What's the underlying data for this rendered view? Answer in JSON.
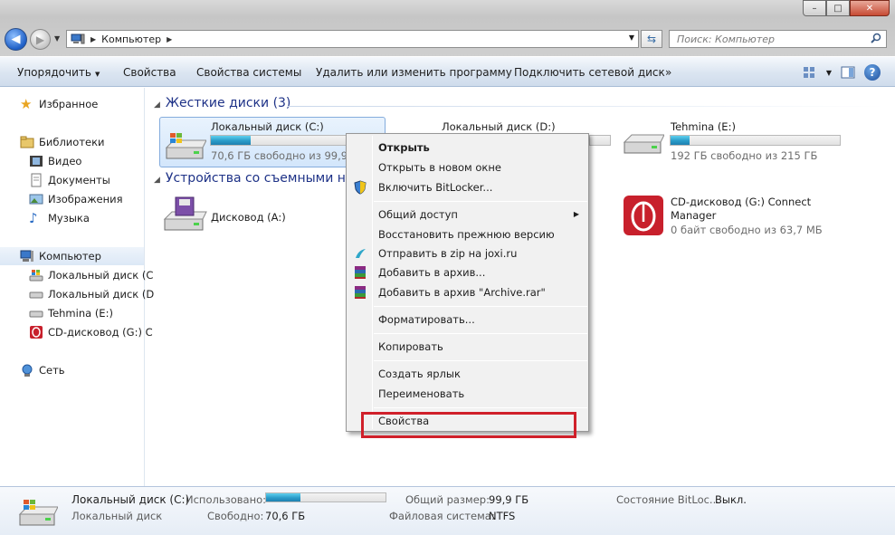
{
  "window": {
    "controls": {
      "minimize": "–",
      "maximize": "□",
      "close": "✕"
    }
  },
  "address": {
    "path": "Компьютер",
    "search_placeholder": "Поиск: Компьютер"
  },
  "toolbar": {
    "organize": "Упорядочить",
    "properties": "Свойства",
    "system_properties": "Свойства системы",
    "uninstall": "Удалить или изменить программу",
    "map_drive": "Подключить сетевой диск",
    "more": "»"
  },
  "sidebar": {
    "favorites": "Избранное",
    "libraries": "Библиотеки",
    "video": "Видео",
    "documents": "Документы",
    "images": "Изображения",
    "music": "Музыка",
    "computer": "Компьютер",
    "local_c": "Локальный диск (C",
    "local_d": "Локальный диск (D",
    "tehmina": "Tehmina (E:)",
    "cd": "CD-дисковод (G:) C",
    "network": "Сеть"
  },
  "groups": {
    "hard_disks": "Жесткие диски (3)",
    "removable": "Устройства со съемными но"
  },
  "drives": {
    "c": {
      "name": "Локальный диск (C:)",
      "free": "70,6 ГБ свободно из 99,9 ГБ",
      "used_fraction": 0.29
    },
    "d": {
      "name": "Локальный диск (D:)"
    },
    "e": {
      "name": "Tehmina (E:)",
      "free": "192 ГБ свободно из 215 ГБ",
      "used_fraction": 0.11
    },
    "a": {
      "name": "Дисковод (A:)"
    },
    "g": {
      "name": "CD-дисковод (G:) Connect",
      "name2": "Manager",
      "free": "0 байт свободно из 63,7 МБ"
    }
  },
  "context_menu": {
    "open": "Открыть",
    "open_new": "Открыть в новом окне",
    "bitlocker": "Включить BitLocker...",
    "share": "Общий доступ",
    "restore": "Восстановить прежнюю версию",
    "zip": "Отправить в zip на joxi.ru",
    "add_archive": "Добавить в архив...",
    "add_rar": "Добавить в архив \"Archive.rar\"",
    "format": "Форматировать...",
    "copy": "Копировать",
    "shortcut": "Создать ярлык",
    "rename": "Переименовать",
    "properties": "Свойства"
  },
  "details": {
    "name": "Локальный диск (C:)",
    "type": "Локальный диск",
    "used_label": "Использовано:",
    "used_fraction": 0.29,
    "free_label": "Свободно:",
    "free_value": "70,6 ГБ",
    "total_label": "Общий размер:",
    "total_value": "99,9 ГБ",
    "fs_label": "Файловая система:",
    "fs_value": "NTFS",
    "bitlocker_label": "Состояние BitLoc...",
    "bitlocker_value": "Выкл."
  },
  "colors": {
    "accent": "#1e3287",
    "bar_fill": "#2a9cc9",
    "highlight": "#d0202a"
  }
}
